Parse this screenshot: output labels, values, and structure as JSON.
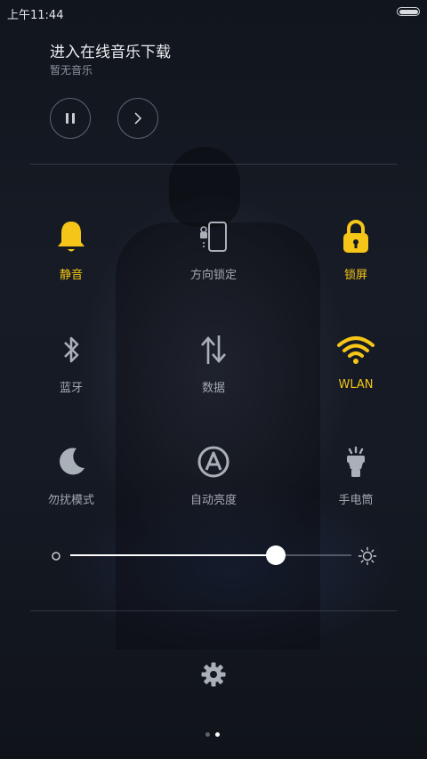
{
  "status_bar": {
    "time": "上午11:44",
    "battery_level": 1.0
  },
  "music": {
    "title": "进入在线音乐下载",
    "subtitle": "暂无音乐",
    "buttons": {
      "play_pause": "pause-icon",
      "next": "chevron-right-icon"
    }
  },
  "toggles": [
    {
      "label": "静音",
      "icon": "bell-icon",
      "on": true
    },
    {
      "label": "方向锁定",
      "icon": "rotation-lock-icon",
      "on": false
    },
    {
      "label": "锁屏",
      "icon": "padlock-icon",
      "on": true
    },
    {
      "label": "蓝牙",
      "icon": "bluetooth-icon",
      "on": false
    },
    {
      "label": "数据",
      "icon": "data-arrows-icon",
      "on": false
    },
    {
      "label": "WLAN",
      "icon": "wifi-icon",
      "on": true
    },
    {
      "label": "勿扰模式",
      "icon": "moon-icon",
      "on": false
    },
    {
      "label": "自动亮度",
      "icon": "auto-brightness-icon",
      "on": false
    },
    {
      "label": "手电筒",
      "icon": "flashlight-icon",
      "on": false
    }
  ],
  "brightness": {
    "level": 0.73
  },
  "settings": {
    "icon": "gear-icon"
  },
  "pager": {
    "pages": 2,
    "active": 1
  },
  "colors": {
    "active": "#f5c518",
    "inactive": "#aab0b8",
    "background": "#141923"
  }
}
